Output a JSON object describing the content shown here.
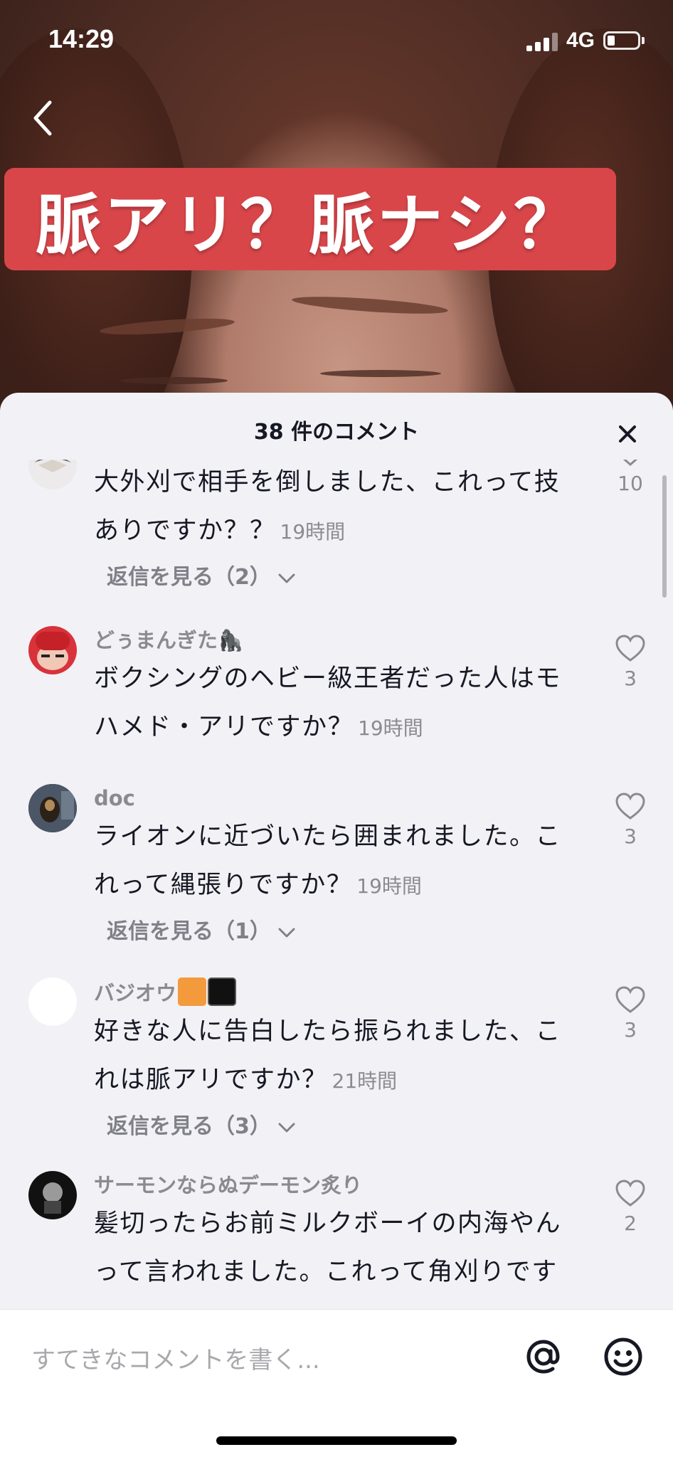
{
  "status_bar": {
    "time": "14:29",
    "network": "4G"
  },
  "video": {
    "title_banner": "脈アリ？脈ナシ？"
  },
  "comments_sheet": {
    "title": "38 件のコメント",
    "comments": [
      {
        "username": "",
        "text": "大外刈で相手を倒しました、これって技ありですか？？",
        "time": "19時間",
        "likes": "10",
        "replies": "返信を見る（2）"
      },
      {
        "username": "どぅまんぎた🦍",
        "text": "ボクシングのヘビー級王者だった人はモハメド・アリですか？",
        "time": "19時間",
        "likes": "3"
      },
      {
        "username": "doc",
        "text": "ライオンに近づいたら囲まれました。これって縄張りですか？",
        "time": "19時間",
        "likes": "3",
        "replies": "返信を見る（1）"
      },
      {
        "username": "バジオウ",
        "text": "好きな人に告白したら振られました、これは脈アリですか？",
        "time": "21時間",
        "likes": "3",
        "replies": "返信を見る（3）"
      },
      {
        "username": "サーモンならぬデーモン炙り",
        "text": "髪切ったらお前ミルクボーイの内海やんって言われました。これって角刈りです",
        "time": "",
        "likes": "2"
      }
    ]
  },
  "input": {
    "placeholder": "すてきなコメントを書く..."
  },
  "colors": {
    "banner": "#d9464a",
    "sheet_bg": "#f2f1f6",
    "text": "#161823",
    "muted": "#8a8b91"
  }
}
